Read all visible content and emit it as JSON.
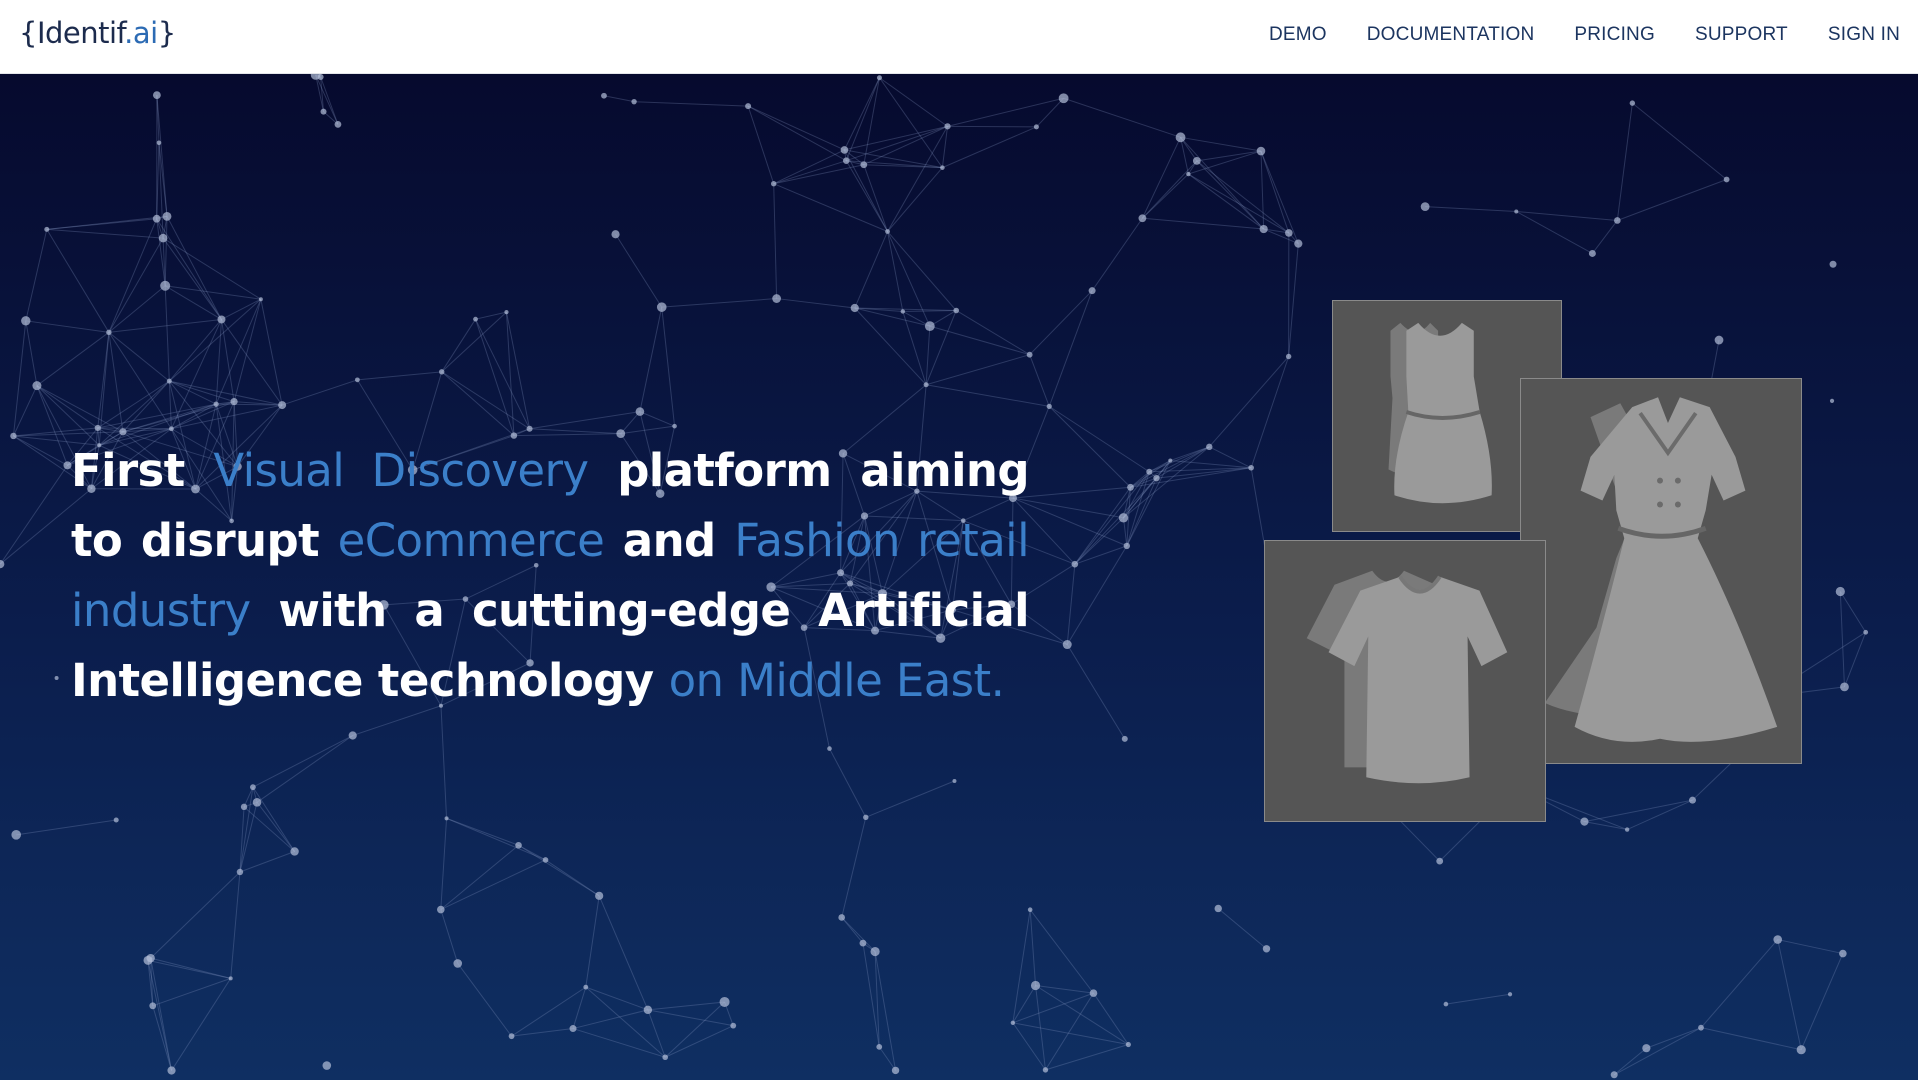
{
  "brand": {
    "part1": "{Identif",
    "part2": ".ai",
    "part3": "}"
  },
  "nav": {
    "links": [
      "DEMO",
      "DOCUMENTATION",
      "PRICING",
      "SUPPORT",
      "SIGN IN"
    ]
  },
  "hero": {
    "tagline": [
      {
        "text": "First ",
        "hl": false
      },
      {
        "text": "Visual Discovery",
        "hl": true
      },
      {
        "text": " platform aiming to disrupt ",
        "hl": false
      },
      {
        "text": "eCommerce",
        "hl": true
      },
      {
        "text": " and ",
        "hl": false
      },
      {
        "text": "Fashion retail industry",
        "hl": true
      },
      {
        "text": " with a cutting-edge Artificial Intelligence technology ",
        "hl": false
      },
      {
        "text": "on Middle East.",
        "hl": true
      }
    ],
    "images": [
      "top-icon",
      "dress-icon",
      "tshirt-icon"
    ]
  },
  "colors": {
    "accent": "#3b7fc9",
    "nav_text": "#1c3560",
    "hero_top": "#060a2e",
    "hero_bottom": "#0f2f62"
  }
}
